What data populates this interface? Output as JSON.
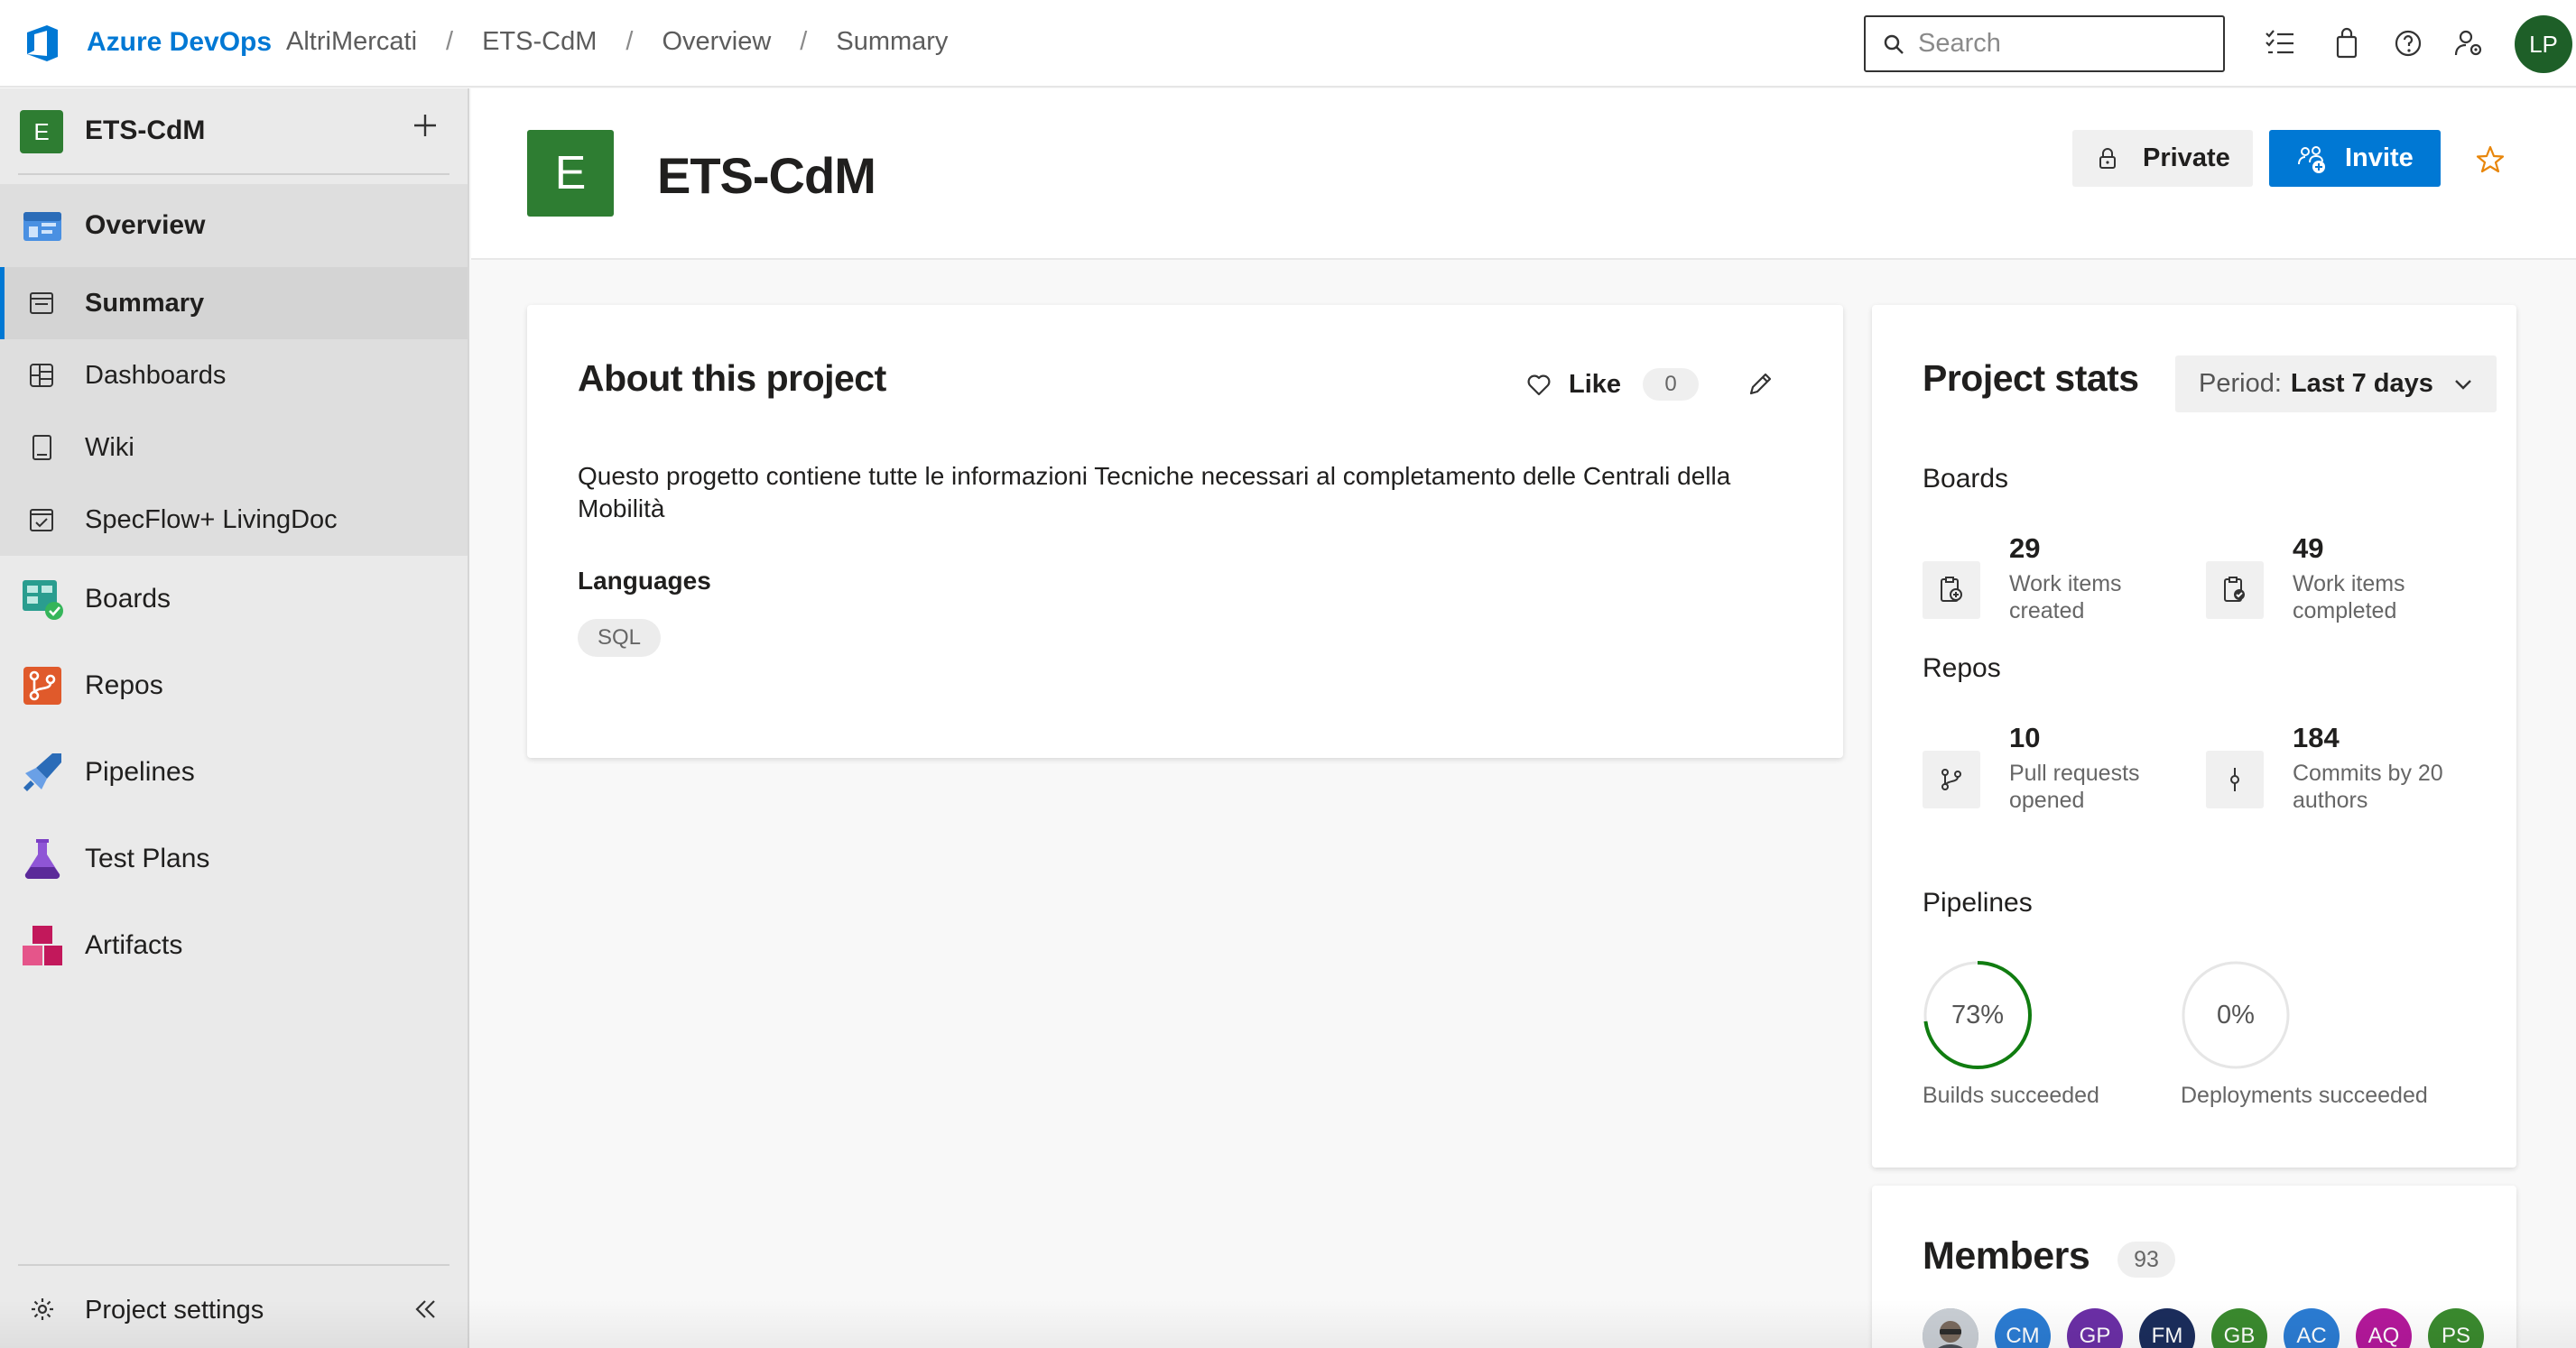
{
  "topbar": {
    "brand": "Azure DevOps",
    "breadcrumbs": [
      "AltriMercati",
      "ETS-CdM",
      "Overview",
      "Summary"
    ],
    "separator": "/",
    "search_placeholder": "Search",
    "user_initials": "LP",
    "accent": "#0078d4",
    "user_color": "#1e5f28"
  },
  "sidebar": {
    "project_initial": "E",
    "project_name": "ETS-CdM",
    "items": [
      {
        "label": "Overview",
        "icon": "overview-icon"
      },
      {
        "label": "Summary",
        "icon": "summary-icon",
        "active": true
      },
      {
        "label": "Dashboards",
        "icon": "dashboards-icon"
      },
      {
        "label": "Wiki",
        "icon": "wiki-icon"
      },
      {
        "label": "SpecFlow+ LivingDoc",
        "icon": "livingdoc-icon"
      },
      {
        "label": "Boards",
        "icon": "boards-icon"
      },
      {
        "label": "Repos",
        "icon": "repos-icon"
      },
      {
        "label": "Pipelines",
        "icon": "pipelines-icon"
      },
      {
        "label": "Test Plans",
        "icon": "test-plans-icon"
      },
      {
        "label": "Artifacts",
        "icon": "artifacts-icon"
      }
    ],
    "settings_label": "Project settings"
  },
  "header": {
    "project_initial": "E",
    "title": "ETS-CdM",
    "private_label": "Private",
    "invite_label": "Invite"
  },
  "about": {
    "title": "About this project",
    "like_label": "Like",
    "like_count": "0",
    "description": "Questo progetto contiene tutte le informazioni Tecniche necessari al completamento delle Centrali della Mobilità",
    "languages_heading": "Languages",
    "languages": [
      "SQL"
    ]
  },
  "stats": {
    "title": "Project stats",
    "period_label": "Period:",
    "period_value": "Last 7 days",
    "boards_heading": "Boards",
    "boards": [
      {
        "value": "29",
        "label": "Work items created"
      },
      {
        "value": "49",
        "label": "Work items completed"
      }
    ],
    "repos_heading": "Repos",
    "repos": [
      {
        "value": "10",
        "label": "Pull requests opened"
      },
      {
        "value": "184",
        "label": "Commits by 20 authors"
      }
    ],
    "pipelines_heading": "Pipelines",
    "pipelines": [
      {
        "value": "73%",
        "fraction": 0.73,
        "label": "Builds succeeded"
      },
      {
        "value": "0%",
        "fraction": 0,
        "label": "Deployments succeeded"
      }
    ],
    "success_color": "#107c10"
  },
  "members": {
    "title": "Members",
    "count": "93",
    "avatars": [
      {
        "initials": "",
        "color": "#9aa3ad",
        "photo": true
      },
      {
        "initials": "CM",
        "color": "#2b7cd3"
      },
      {
        "initials": "GP",
        "color": "#6b2fa6"
      },
      {
        "initials": "FM",
        "color": "#1b2d5c"
      },
      {
        "initials": "GB",
        "color": "#3a8a2e"
      },
      {
        "initials": "AC",
        "color": "#2b7cd3"
      },
      {
        "initials": "AQ",
        "color": "#b4189b"
      },
      {
        "initials": "PS",
        "color": "#3a8a2e"
      }
    ]
  }
}
